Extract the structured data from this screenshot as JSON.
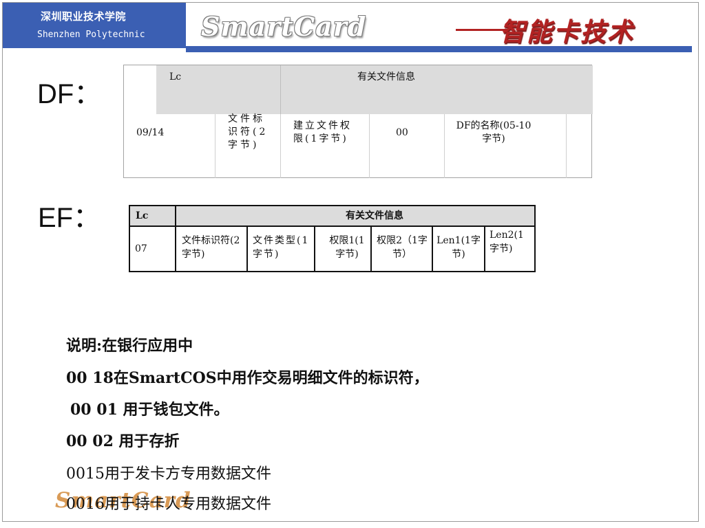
{
  "header": {
    "school_cn": "深圳职业技术学院",
    "school_en": "Shenzhen Polytechnic",
    "logo_en": "SmartCard",
    "logo_cn": "智能卡技术",
    "colors": {
      "bar": "#3b5fb3",
      "logo_cn": "#b22222"
    }
  },
  "df": {
    "label": "DF：",
    "table": {
      "header": {
        "lc": "Lc",
        "info": "有关文件信息"
      },
      "row": {
        "lc": "09/14",
        "file_id": "文件标识符(2字节)",
        "create_perm": "建立文件权限(1字节)",
        "reserved": "00",
        "name": "DF的名称(05-10字节)"
      }
    }
  },
  "ef": {
    "label": "EF：",
    "table": {
      "header": {
        "lc": "Lc",
        "info": "有关文件信息"
      },
      "row": {
        "lc": "07",
        "file_id": "文件标识符(2字节)",
        "file_type": "文件类型(1字节)",
        "perm1": "权限1(1字节)",
        "perm2": "权限2（1字节）",
        "len1": "Len1(1字节)",
        "len2": "Len2(1字节)"
      }
    }
  },
  "notes": [
    "说明:在银行应用中",
    "00 18在SmartCOS中用作交易明细文件的标识符，",
    "00 01 用于钱包文件。",
    "00 02 用于存折",
    "0015用于发卡方专用数据文件",
    "0016用于持卡人专用数据文件"
  ],
  "watermark": "SmartCard"
}
